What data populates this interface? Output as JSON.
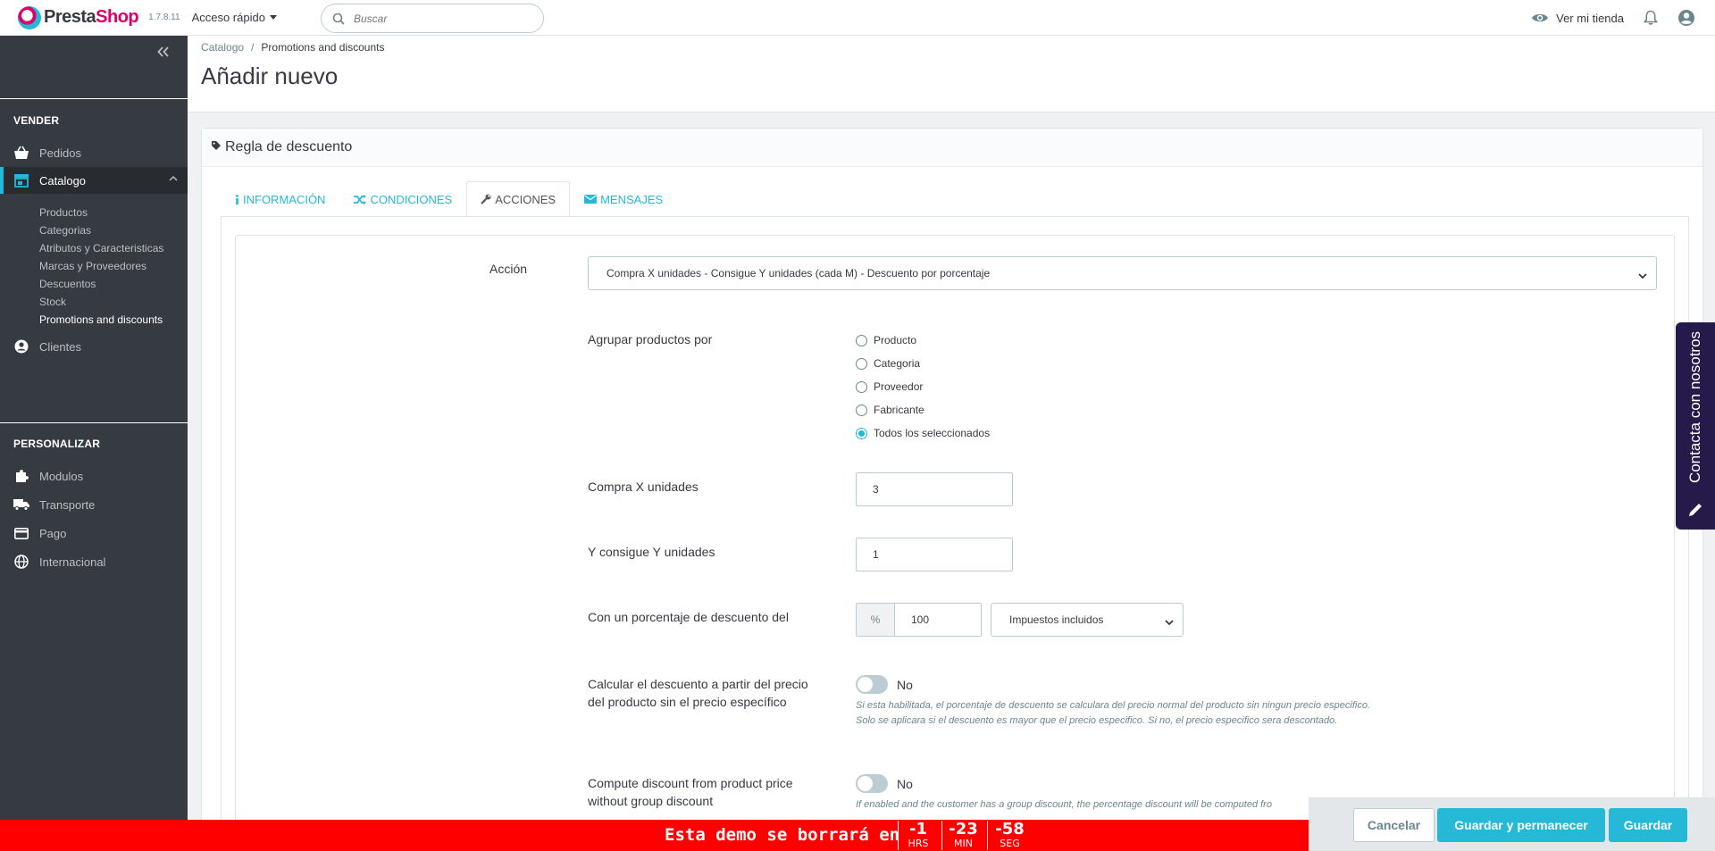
{
  "header": {
    "logo_text_a": "Presta",
    "logo_text_b": "Shop",
    "version": "1.7.8.11",
    "quick_access": "Acceso rápido",
    "search_placeholder": "Buscar",
    "view_store": "Ver mi tienda"
  },
  "sidebar": {
    "section_sell": "VENDER",
    "section_customize": "PERSONALIZAR",
    "items": {
      "orders": "Pedidos",
      "catalog": "Catalogo",
      "customers": "Clientes",
      "modules": "Modulos",
      "shipping": "Transporte",
      "payment": "Pago",
      "international": "Internacional"
    },
    "catalog_sub": [
      "Productos",
      "Categorias",
      "Atributos y Caracteristicas",
      "Marcas y Proveedores",
      "Descuentos",
      "Stock",
      "Promotions and discounts"
    ]
  },
  "page": {
    "breadcrumb_parent": "Catalogo",
    "breadcrumb_sep": "/",
    "breadcrumb_current": "Promotions and discounts",
    "title": "Añadir nuevo"
  },
  "panel": {
    "title": "Regla de descuento",
    "tabs": [
      "INFORMACIÓN",
      "CONDICIONES",
      "ACCIONES",
      "MENSAJES"
    ]
  },
  "form": {
    "action_label": "Acción",
    "action_value": "Compra X unidades - Consigue Y unidades (cada M) - Descuento por porcentaje",
    "group_label": "Agrupar productos por",
    "group_options": [
      "Producto",
      "Categoria",
      "Proveedor",
      "Fabricante",
      "Todos los seleccionados"
    ],
    "group_selected": "Todos los seleccionados",
    "buy_x_label": "Compra X unidades",
    "buy_x_value": "3",
    "get_y_label": "Y consigue Y unidades",
    "get_y_value": "1",
    "percent_label": "Con un porcentaje de descuento del",
    "percent_addon": "%",
    "percent_value": "100",
    "tax_value": "Impuestos incluidos",
    "calc_label_1": "Calcular el descuento a partir del precio",
    "calc_label_2": "del producto sin el precio específico",
    "calc_switch": "No",
    "calc_help_1": "Si esta habilitada, el porcentaje de descuento se calculara del precio normal del producto sin ningun precio especifico.",
    "calc_help_2": "Solo se aplicara si el descuento es mayor que el precio especifico. Si no, el precio especifico sera descontado.",
    "group_disc_label_1": "Compute discount from product price",
    "group_disc_label_2": "without group discount",
    "group_disc_switch": "No",
    "group_disc_help": "If enabled and the customer has a group discount, the percentage discount will be computed fro"
  },
  "contact": {
    "label": "Contacta con nosotros"
  },
  "actions": {
    "cancel": "Cancelar",
    "save_stay": "Guardar y permanecer",
    "save": "Guardar"
  },
  "demo": {
    "text": "Esta demo se borrará en",
    "hours": "-1",
    "hours_unit": "HRS",
    "minutes": "-23",
    "minutes_unit": "MIN",
    "seconds": "-58",
    "seconds_unit": "SEG"
  },
  "colors": {
    "accent": "#25b9d7",
    "sidebar": "#363a41",
    "brand_pink": "#df0067",
    "demo_red": "#ff0000",
    "contact_bg": "#261a4a"
  }
}
